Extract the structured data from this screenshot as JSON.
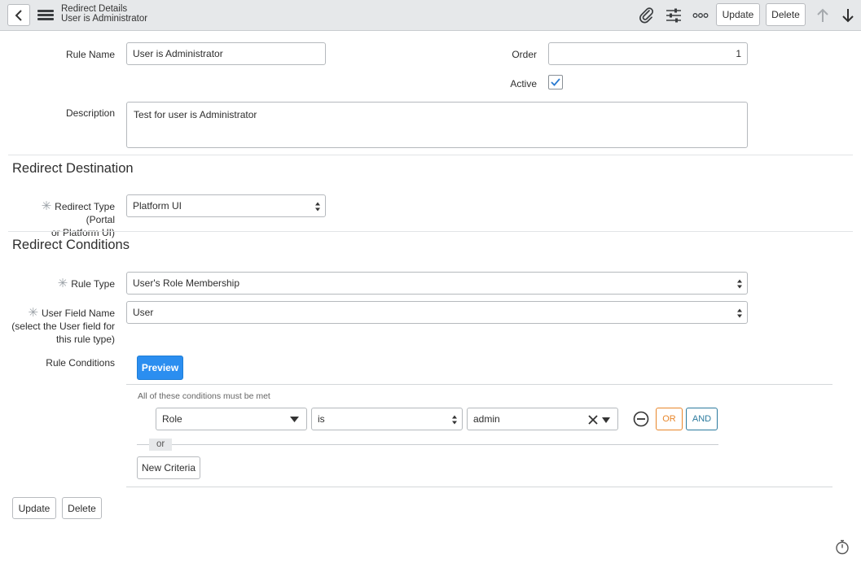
{
  "header": {
    "title": "Redirect Details",
    "subtitle": "User is Administrator",
    "update_label": "Update",
    "delete_label": "Delete"
  },
  "form": {
    "rule_name_label": "Rule Name",
    "rule_name_value": "User is Administrator",
    "order_label": "Order",
    "order_value": "1",
    "active_label": "Active",
    "active_checked": true,
    "description_label": "Description",
    "description_value": "Test for user is Administrator"
  },
  "destination": {
    "section_title": "Redirect Destination",
    "redirect_type_label_line1": "Redirect Type (Portal",
    "redirect_type_label_line2": "or Platform UI)",
    "redirect_type_value": "Platform UI"
  },
  "conditions": {
    "section_title": "Redirect Conditions",
    "rule_type_label": "Rule Type",
    "rule_type_value": "User's Role Membership",
    "user_field_label_line1": "User Field Name",
    "user_field_label_line2": "(select the User field for",
    "user_field_label_line3": "this rule type)",
    "user_field_value": "User",
    "rule_conditions_label": "Rule Conditions",
    "preview_label": "Preview",
    "must_be_met_text": "All of these conditions must be met",
    "condition_field": "Role",
    "condition_operator": "is",
    "condition_value": "admin",
    "or_button": "OR",
    "and_button": "AND",
    "or_separator": "or",
    "new_criteria_label": "New Criteria"
  },
  "footer": {
    "update_label": "Update",
    "delete_label": "Delete"
  },
  "colors": {
    "primary": "#2b8ef0",
    "or_accent": "#e8862a",
    "and_accent": "#2b7a9e",
    "checkbox_check": "#2b7bd1"
  }
}
